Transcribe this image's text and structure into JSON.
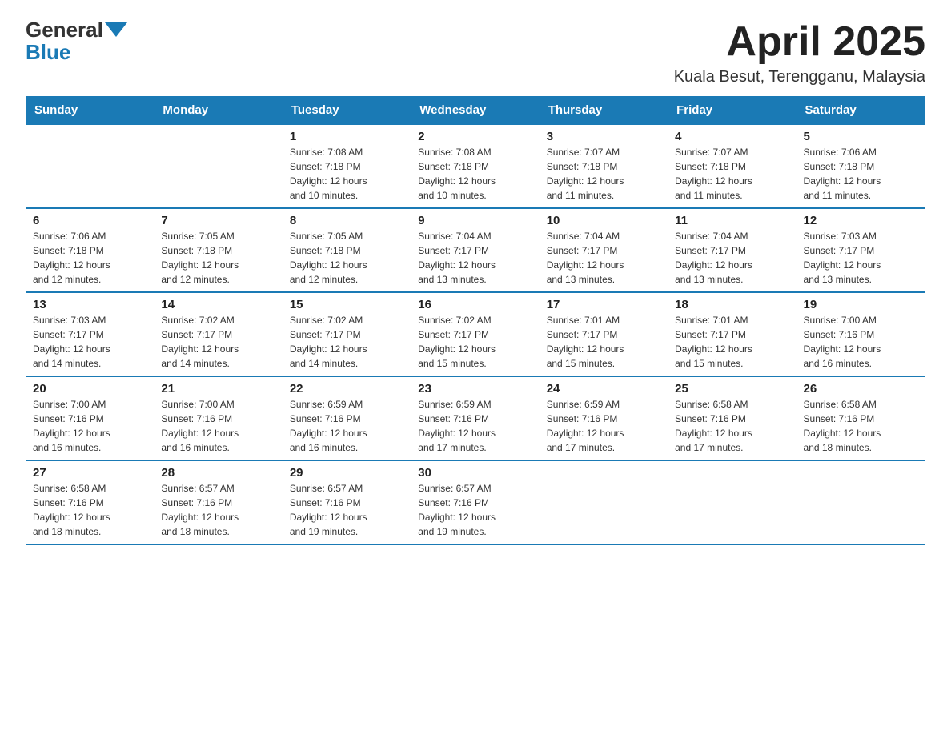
{
  "header": {
    "logo_general": "General",
    "logo_blue": "Blue",
    "month_year": "April 2025",
    "location": "Kuala Besut, Terengganu, Malaysia"
  },
  "days_of_week": [
    "Sunday",
    "Monday",
    "Tuesday",
    "Wednesday",
    "Thursday",
    "Friday",
    "Saturday"
  ],
  "weeks": [
    [
      {
        "day": "",
        "info": ""
      },
      {
        "day": "",
        "info": ""
      },
      {
        "day": "1",
        "info": "Sunrise: 7:08 AM\nSunset: 7:18 PM\nDaylight: 12 hours\nand 10 minutes."
      },
      {
        "day": "2",
        "info": "Sunrise: 7:08 AM\nSunset: 7:18 PM\nDaylight: 12 hours\nand 10 minutes."
      },
      {
        "day": "3",
        "info": "Sunrise: 7:07 AM\nSunset: 7:18 PM\nDaylight: 12 hours\nand 11 minutes."
      },
      {
        "day": "4",
        "info": "Sunrise: 7:07 AM\nSunset: 7:18 PM\nDaylight: 12 hours\nand 11 minutes."
      },
      {
        "day": "5",
        "info": "Sunrise: 7:06 AM\nSunset: 7:18 PM\nDaylight: 12 hours\nand 11 minutes."
      }
    ],
    [
      {
        "day": "6",
        "info": "Sunrise: 7:06 AM\nSunset: 7:18 PM\nDaylight: 12 hours\nand 12 minutes."
      },
      {
        "day": "7",
        "info": "Sunrise: 7:05 AM\nSunset: 7:18 PM\nDaylight: 12 hours\nand 12 minutes."
      },
      {
        "day": "8",
        "info": "Sunrise: 7:05 AM\nSunset: 7:18 PM\nDaylight: 12 hours\nand 12 minutes."
      },
      {
        "day": "9",
        "info": "Sunrise: 7:04 AM\nSunset: 7:17 PM\nDaylight: 12 hours\nand 13 minutes."
      },
      {
        "day": "10",
        "info": "Sunrise: 7:04 AM\nSunset: 7:17 PM\nDaylight: 12 hours\nand 13 minutes."
      },
      {
        "day": "11",
        "info": "Sunrise: 7:04 AM\nSunset: 7:17 PM\nDaylight: 12 hours\nand 13 minutes."
      },
      {
        "day": "12",
        "info": "Sunrise: 7:03 AM\nSunset: 7:17 PM\nDaylight: 12 hours\nand 13 minutes."
      }
    ],
    [
      {
        "day": "13",
        "info": "Sunrise: 7:03 AM\nSunset: 7:17 PM\nDaylight: 12 hours\nand 14 minutes."
      },
      {
        "day": "14",
        "info": "Sunrise: 7:02 AM\nSunset: 7:17 PM\nDaylight: 12 hours\nand 14 minutes."
      },
      {
        "day": "15",
        "info": "Sunrise: 7:02 AM\nSunset: 7:17 PM\nDaylight: 12 hours\nand 14 minutes."
      },
      {
        "day": "16",
        "info": "Sunrise: 7:02 AM\nSunset: 7:17 PM\nDaylight: 12 hours\nand 15 minutes."
      },
      {
        "day": "17",
        "info": "Sunrise: 7:01 AM\nSunset: 7:17 PM\nDaylight: 12 hours\nand 15 minutes."
      },
      {
        "day": "18",
        "info": "Sunrise: 7:01 AM\nSunset: 7:17 PM\nDaylight: 12 hours\nand 15 minutes."
      },
      {
        "day": "19",
        "info": "Sunrise: 7:00 AM\nSunset: 7:16 PM\nDaylight: 12 hours\nand 16 minutes."
      }
    ],
    [
      {
        "day": "20",
        "info": "Sunrise: 7:00 AM\nSunset: 7:16 PM\nDaylight: 12 hours\nand 16 minutes."
      },
      {
        "day": "21",
        "info": "Sunrise: 7:00 AM\nSunset: 7:16 PM\nDaylight: 12 hours\nand 16 minutes."
      },
      {
        "day": "22",
        "info": "Sunrise: 6:59 AM\nSunset: 7:16 PM\nDaylight: 12 hours\nand 16 minutes."
      },
      {
        "day": "23",
        "info": "Sunrise: 6:59 AM\nSunset: 7:16 PM\nDaylight: 12 hours\nand 17 minutes."
      },
      {
        "day": "24",
        "info": "Sunrise: 6:59 AM\nSunset: 7:16 PM\nDaylight: 12 hours\nand 17 minutes."
      },
      {
        "day": "25",
        "info": "Sunrise: 6:58 AM\nSunset: 7:16 PM\nDaylight: 12 hours\nand 17 minutes."
      },
      {
        "day": "26",
        "info": "Sunrise: 6:58 AM\nSunset: 7:16 PM\nDaylight: 12 hours\nand 18 minutes."
      }
    ],
    [
      {
        "day": "27",
        "info": "Sunrise: 6:58 AM\nSunset: 7:16 PM\nDaylight: 12 hours\nand 18 minutes."
      },
      {
        "day": "28",
        "info": "Sunrise: 6:57 AM\nSunset: 7:16 PM\nDaylight: 12 hours\nand 18 minutes."
      },
      {
        "day": "29",
        "info": "Sunrise: 6:57 AM\nSunset: 7:16 PM\nDaylight: 12 hours\nand 19 minutes."
      },
      {
        "day": "30",
        "info": "Sunrise: 6:57 AM\nSunset: 7:16 PM\nDaylight: 12 hours\nand 19 minutes."
      },
      {
        "day": "",
        "info": ""
      },
      {
        "day": "",
        "info": ""
      },
      {
        "day": "",
        "info": ""
      }
    ]
  ]
}
